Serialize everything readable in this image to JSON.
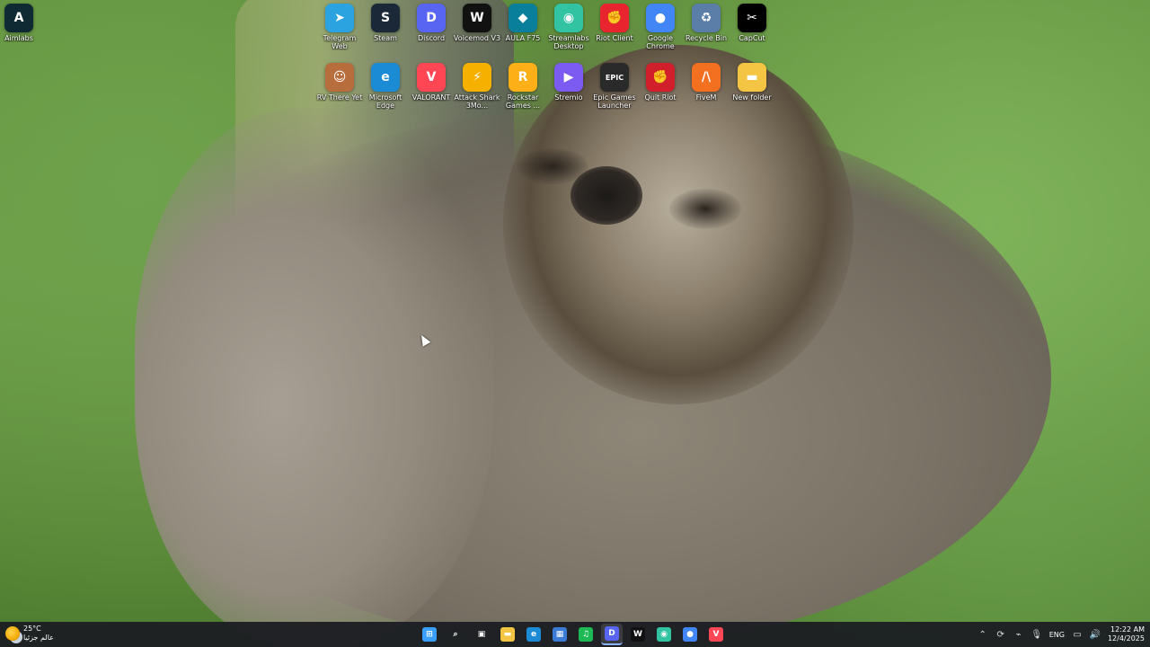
{
  "desktop": {
    "icons": [
      {
        "id": "aimlabs",
        "label": "Aimlabs",
        "icon": "aimlabs-icon",
        "color": "#0f2a33",
        "glyph": "A"
      },
      {
        "id": "telegram",
        "label": "Telegram Web",
        "icon": "telegram-icon",
        "color": "#2aa3e0",
        "glyph": "➤"
      },
      {
        "id": "steam",
        "label": "Steam",
        "icon": "steam-icon",
        "color": "#1b2838",
        "glyph": "S"
      },
      {
        "id": "discord",
        "label": "Discord",
        "icon": "discord-icon",
        "color": "#5865f2",
        "glyph": "D"
      },
      {
        "id": "voicemod",
        "label": "Voicemod V3",
        "icon": "voicemod-icon",
        "color": "#111111",
        "glyph": "W"
      },
      {
        "id": "aula",
        "label": "AULA F75",
        "icon": "aula-icon",
        "color": "#0a7f9c",
        "glyph": "◆"
      },
      {
        "id": "streamlabs",
        "label": "Streamlabs Desktop",
        "icon": "streamlabs-icon",
        "color": "#31c3a2",
        "glyph": "◉"
      },
      {
        "id": "riot-client",
        "label": "Riot Client",
        "icon": "riot-client-icon",
        "color": "#e8242e",
        "glyph": "✊"
      },
      {
        "id": "chrome",
        "label": "Google Chrome",
        "icon": "chrome-icon",
        "color": "#4285f4",
        "glyph": "●"
      },
      {
        "id": "recycle-bin",
        "label": "Recycle Bin",
        "icon": "recycle-bin-icon",
        "color": "#5a7ea8",
        "glyph": "♻"
      },
      {
        "id": "capcut",
        "label": "CapCut",
        "icon": "capcut-icon",
        "color": "#000000",
        "glyph": "✂"
      },
      {
        "id": "rv-there-yet",
        "label": "RV There Yet",
        "icon": "rv-there-yet-icon",
        "color": "#b86d3c",
        "glyph": "☺"
      },
      {
        "id": "edge",
        "label": "Microsoft Edge",
        "icon": "edge-icon",
        "color": "#1c8bd6",
        "glyph": "e"
      },
      {
        "id": "valorant",
        "label": "VALORANT",
        "icon": "valorant-icon",
        "color": "#ff4655",
        "glyph": "V"
      },
      {
        "id": "attack-shark",
        "label": "Attack Shark 3Mo...",
        "icon": "attack-shark-icon",
        "color": "#f5b000",
        "glyph": "⚡"
      },
      {
        "id": "rockstar",
        "label": "Rockstar Games ...",
        "icon": "rockstar-icon",
        "color": "#fcaf17",
        "glyph": "R"
      },
      {
        "id": "stremio",
        "label": "Stremio",
        "icon": "stremio-icon",
        "color": "#7b5bf2",
        "glyph": "▶"
      },
      {
        "id": "epic",
        "label": "Epic Games Launcher",
        "icon": "epic-games-icon",
        "color": "#2a2a2a",
        "glyph": "EPIC"
      },
      {
        "id": "quit-riot",
        "label": "Quit Riot",
        "icon": "quit-riot-icon",
        "color": "#d11f2b",
        "glyph": "✊"
      },
      {
        "id": "fivem",
        "label": "FiveM",
        "icon": "fivem-icon",
        "color": "#f37021",
        "glyph": "/\\"
      },
      {
        "id": "new-folder",
        "label": "New folder",
        "icon": "folder-icon",
        "color": "#f4c542",
        "glyph": "▬"
      }
    ]
  },
  "taskbar": {
    "weather": {
      "temp": "25°C",
      "desc": "عالم جزئيا"
    },
    "apps": [
      {
        "id": "start",
        "icon": "windows-start-icon",
        "color": "#3aa0ff",
        "glyph": "⊞"
      },
      {
        "id": "search",
        "icon": "search-icon",
        "color": "transparent",
        "glyph": "⌕"
      },
      {
        "id": "task-view",
        "icon": "task-view-icon",
        "color": "transparent",
        "glyph": "▣"
      },
      {
        "id": "file-explorer",
        "icon": "file-explorer-icon",
        "color": "#f4c542",
        "glyph": "▬"
      },
      {
        "id": "edge",
        "icon": "edge-icon",
        "color": "#1c8bd6",
        "glyph": "e"
      },
      {
        "id": "store",
        "icon": "store-icon",
        "color": "#3a7bd5",
        "glyph": "▦"
      },
      {
        "id": "spotify",
        "icon": "spotify-icon",
        "color": "#1db954",
        "glyph": "♫"
      },
      {
        "id": "discord",
        "icon": "discord-icon",
        "color": "#5865f2",
        "glyph": "D"
      },
      {
        "id": "voicemod",
        "icon": "voicemod-icon",
        "color": "#111111",
        "glyph": "W"
      },
      {
        "id": "streamlabs",
        "icon": "streamlabs-icon",
        "color": "#31c3a2",
        "glyph": "◉"
      },
      {
        "id": "chrome",
        "icon": "chrome-icon",
        "color": "#4285f4",
        "glyph": "●"
      },
      {
        "id": "valorant",
        "icon": "valorant-icon",
        "color": "#ff4655",
        "glyph": "V"
      }
    ],
    "active_app": "discord",
    "tray": {
      "language": "ENG",
      "time": "12:22 AM",
      "date": "12/4/2025"
    }
  }
}
